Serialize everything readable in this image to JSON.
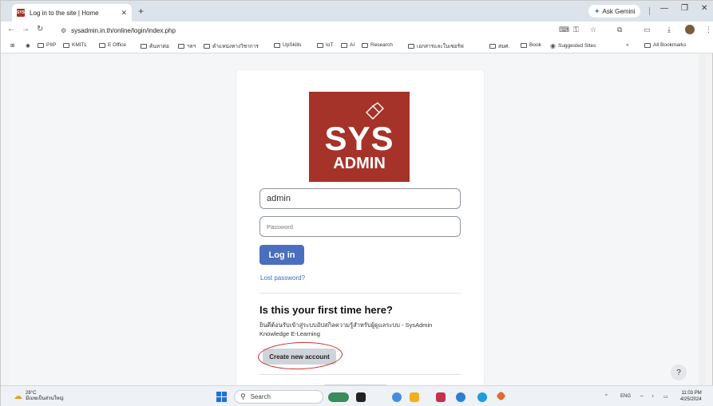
{
  "browser": {
    "tab_title": "Log in to the site | Home",
    "tab_favicon_text": "SYS",
    "new_tab": "+",
    "gemini_label": "Ask Gemini",
    "url": "sysadmin.in.th/online/login/index.php"
  },
  "bookmarks": {
    "items": [
      "PIIP",
      "KMITL",
      "E Office",
      "ค้นหาต่อ",
      "ฯลฯ",
      "ตำแหน่งทางวิชาการ",
      "UpSkills",
      "IoT",
      "AI",
      "Research",
      "เอกสารและใบเซอร์ฟ",
      "สมศ.",
      "Book"
    ],
    "suggested": "Suggested Sites",
    "more": "»",
    "all": "All Bookmarks"
  },
  "login": {
    "logo_top": "SYS",
    "logo_bottom": "ADMIN",
    "username_value": "admin",
    "password_placeholder": "Password",
    "login_button": "Log in",
    "lost_password": "Lost password?",
    "first_time_title": "Is this your first time here?",
    "welcome_text": "ยินดีต้อนรับเข้าสู่ระบบอัปสกิลความรู้สำหรับผู้ดูแลระบบ - SysAdmin Knowledge E-Learning",
    "create_account": "Create new account",
    "annotation_color": "#d02a2a"
  },
  "help_label": "?",
  "taskbar": {
    "weather_temp": "28°C",
    "weather_desc": "มีเมฆเป็นส่วนใหญ่",
    "search_placeholder": "Search",
    "lang": "ENG",
    "time": "11:03 PM",
    "date": "4/25/2024"
  }
}
